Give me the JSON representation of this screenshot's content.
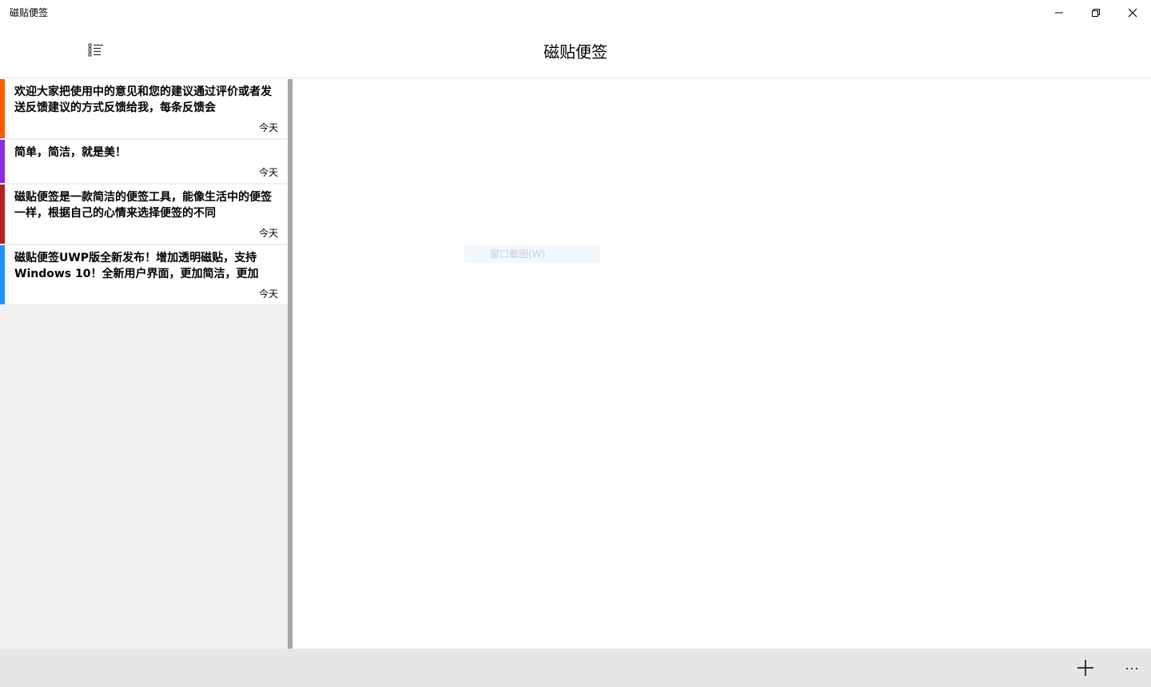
{
  "window": {
    "title": "磁贴便签"
  },
  "header": {
    "title": "磁贴便签",
    "list_icon": "list-view-icon"
  },
  "notes": [
    {
      "text": "欢迎大家把使用中的意见和您的建议通过评价或者发送反馈建议的方式反馈给我，每条反馈会",
      "date": "今天",
      "color": "#ff5a00"
    },
    {
      "text": "简单，简洁，就是美！",
      "date": "今天",
      "color": "#8a2be2"
    },
    {
      "text": "磁贴便签是一款简洁的便签工具，能像生活中的便签一样，根据自己的心情来选择便签的不同",
      "date": "今天",
      "color": "#b22222"
    },
    {
      "text": "磁贴便签UWP版全新发布！增加透明磁贴，支持Windows 10！全新用户界面，更加简洁，更加",
      "date": "今天",
      "color": "#1e90ff"
    }
  ],
  "overlay": {
    "text": "窗口截图(W)"
  },
  "appbar": {
    "add_icon": "plus-icon",
    "more_icon": "more-icon"
  },
  "colors": {
    "left_pane_bg": "#f0f0f0",
    "appbar_bg": "#e6e6e6",
    "splitter": "#a6a6a6"
  }
}
